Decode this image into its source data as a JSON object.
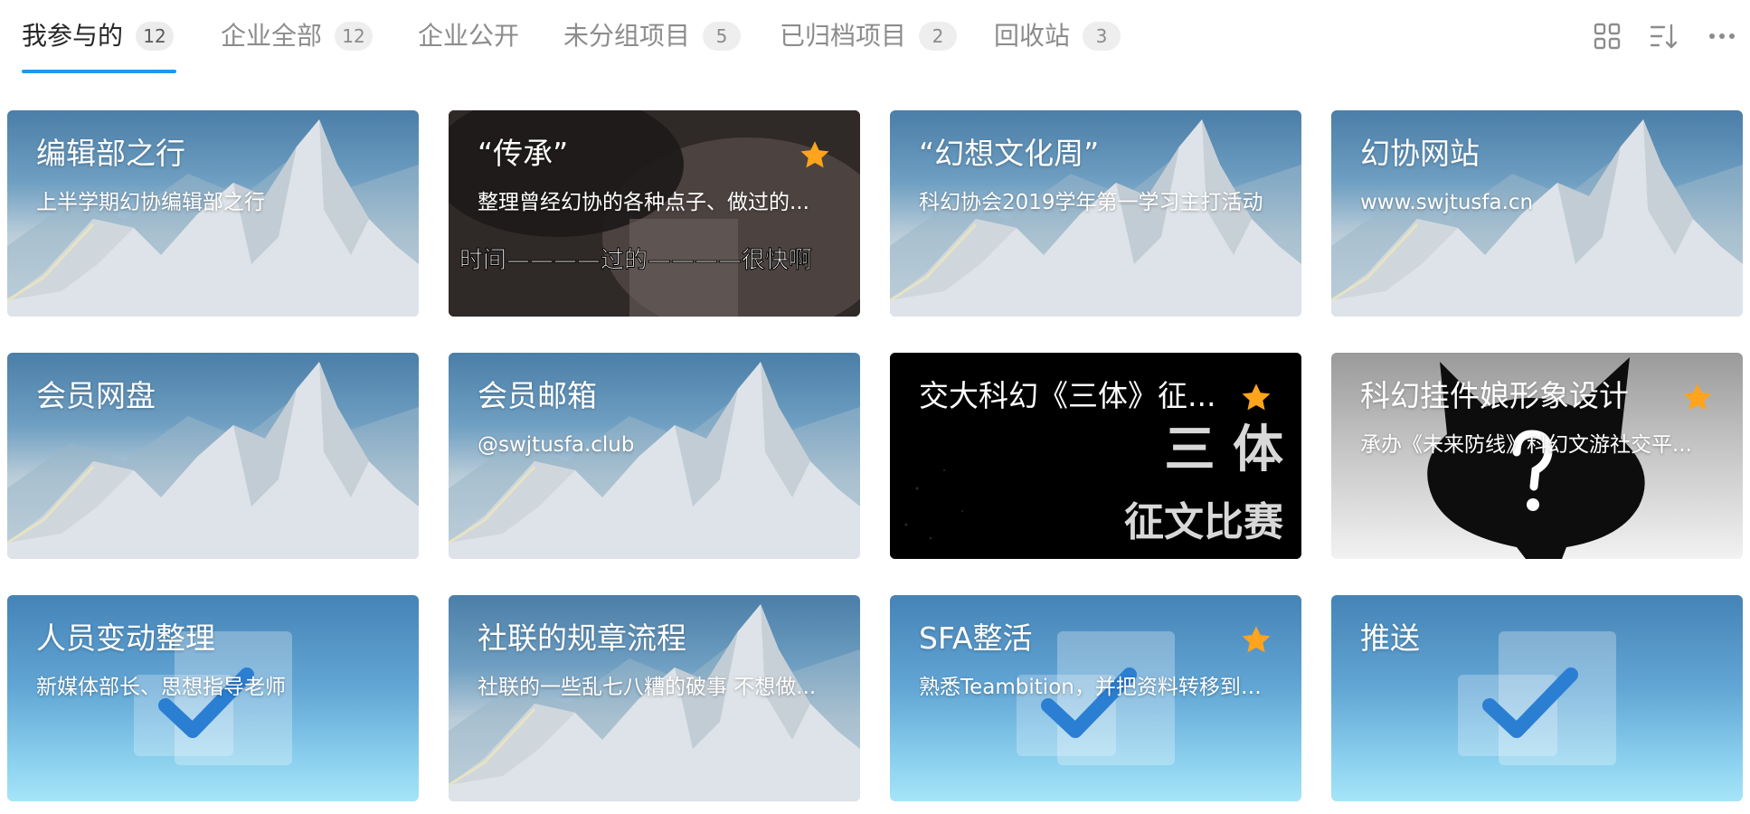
{
  "tabs": [
    {
      "label": "我参与的",
      "count": "12",
      "active": true
    },
    {
      "label": "企业全部",
      "count": "12",
      "active": false
    },
    {
      "label": "企业公开",
      "count": "",
      "active": false
    },
    {
      "label": "未分组项目",
      "count": "5",
      "active": false
    },
    {
      "label": "已归档项目",
      "count": "2",
      "active": false
    },
    {
      "label": "回收站",
      "count": "3",
      "active": false
    }
  ],
  "toolbar": {
    "icons": [
      "grid-view-icon",
      "sort-icon",
      "more-icon"
    ]
  },
  "colors": {
    "accent": "#1b9aee",
    "star": "#ffa41c",
    "text_primary": "#262626",
    "text_secondary": "#8c8c8c"
  },
  "projects": [
    {
      "title": "编辑部之行",
      "desc": "上半学期幻协编辑部之行",
      "starred": false,
      "cover": "mountain"
    },
    {
      "title": "“传承”",
      "desc": "整理曾经幻协的各种点子、做过的...",
      "starred": true,
      "cover": "photo",
      "cover_text": "时间————过的————很快啊"
    },
    {
      "title": "“幻想文化周”",
      "desc": "科幻协会2019学年第一学习主打活动",
      "starred": false,
      "cover": "mountain"
    },
    {
      "title": "幻协网站",
      "desc": "www.swjtusfa.cn",
      "starred": false,
      "cover": "mountain"
    },
    {
      "title": "会员网盘",
      "desc": "",
      "starred": false,
      "cover": "mountain"
    },
    {
      "title": "会员邮箱",
      "desc": "@swjtusfa.club",
      "starred": false,
      "cover": "mountain"
    },
    {
      "title": "交大科幻《三体》征...",
      "desc": "",
      "starred": true,
      "cover": "dark",
      "cover_text_1": "三 体",
      "cover_text_2": "征文比赛"
    },
    {
      "title": "科幻挂件娘形象设计",
      "desc": "承办《未来防线》科幻文游社交平...",
      "starred": true,
      "cover": "cat"
    },
    {
      "title": "人员变动整理",
      "desc": "新媒体部长、思想指导老师",
      "starred": false,
      "cover": "check"
    },
    {
      "title": "社联的规章流程",
      "desc": "社联的一些乱七八糟的破事 不想做...",
      "starred": false,
      "cover": "mountain"
    },
    {
      "title": "SFA整活",
      "desc": "熟悉Teambition，并把资料转移到T...",
      "starred": true,
      "cover": "check"
    },
    {
      "title": "推送",
      "desc": "",
      "starred": false,
      "cover": "check"
    }
  ]
}
